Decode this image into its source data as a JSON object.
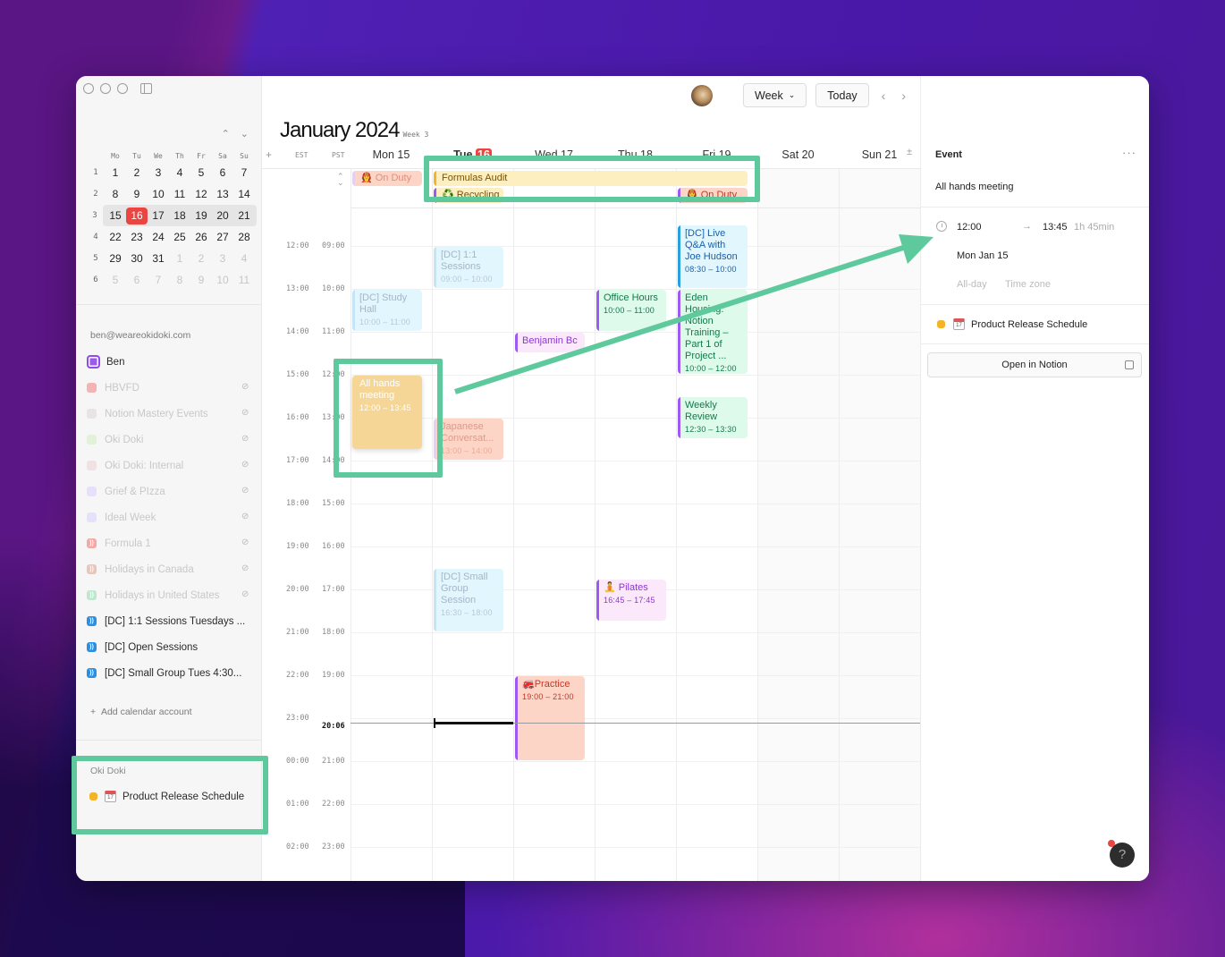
{
  "window": {
    "title": "January 2024",
    "week_label": "Week 3"
  },
  "mini_calendar": {
    "weekday_headers": [
      "Mo",
      "Tu",
      "We",
      "Th",
      "Fr",
      "Sa",
      "Su"
    ],
    "weeks": [
      {
        "num": "1",
        "days": [
          "1",
          "2",
          "3",
          "4",
          "5",
          "6",
          "7"
        ],
        "muted": []
      },
      {
        "num": "2",
        "days": [
          "8",
          "9",
          "10",
          "11",
          "12",
          "13",
          "14"
        ],
        "muted": []
      },
      {
        "num": "3",
        "days": [
          "15",
          "16",
          "17",
          "18",
          "19",
          "20",
          "21"
        ],
        "muted": [],
        "current": true,
        "today_index": 1
      },
      {
        "num": "4",
        "days": [
          "22",
          "23",
          "24",
          "25",
          "26",
          "27",
          "28"
        ],
        "muted": []
      },
      {
        "num": "5",
        "days": [
          "29",
          "30",
          "31",
          "1",
          "2",
          "3",
          "4"
        ],
        "muted": [
          3,
          4,
          5,
          6
        ]
      },
      {
        "num": "6",
        "days": [
          "5",
          "6",
          "7",
          "8",
          "9",
          "10",
          "11"
        ],
        "muted": [
          0,
          1,
          2,
          3,
          4,
          5,
          6
        ]
      }
    ]
  },
  "sidebar": {
    "account_email": "ben@weareokidoki.com",
    "calendars": [
      {
        "label": "Ben",
        "color": "#9c5af2",
        "hidden": false,
        "type": "checkbox"
      },
      {
        "label": "HBVFD",
        "color": "#f4b4b4",
        "hidden": true,
        "type": "square"
      },
      {
        "label": "Notion Mastery Events",
        "color": "#e8e4e4",
        "hidden": true,
        "type": "square"
      },
      {
        "label": "Oki Doki",
        "color": "#e2f2d8",
        "hidden": true,
        "type": "square"
      },
      {
        "label": "Oki Doki: Internal",
        "color": "#f0e2e2",
        "hidden": true,
        "type": "square"
      },
      {
        "label": "Grief & PIzza",
        "color": "#e6e0fa",
        "hidden": true,
        "type": "square"
      },
      {
        "label": "Ideal Week",
        "color": "#e6e0fa",
        "hidden": true,
        "type": "square"
      },
      {
        "label": "Formula 1",
        "color": "#f4a8a8",
        "hidden": true,
        "type": "rss"
      },
      {
        "label": "Holidays in Canada",
        "color": "#e8c6bc",
        "hidden": true,
        "type": "rss"
      },
      {
        "label": "Holidays in United States",
        "color": "#bfe6cf",
        "hidden": true,
        "type": "rss"
      },
      {
        "label": "[DC] 1:1 Sessions Tuesdays ...",
        "color": "#2a8fe0",
        "hidden": false,
        "type": "rss"
      },
      {
        "label": "[DC] Open Sessions",
        "color": "#2a8fe0",
        "hidden": false,
        "type": "rss"
      },
      {
        "label": "[DC] Small Group Tues 4:30...",
        "color": "#2a8fe0",
        "hidden": false,
        "type": "rss"
      }
    ],
    "add_account_label": "Add calendar account",
    "notion_section": {
      "title": "Oki Doki",
      "item": "Product Release Schedule",
      "color": "#f4b429"
    }
  },
  "toolbar": {
    "view_label": "Week",
    "today_label": "Today"
  },
  "day_headers": [
    {
      "label": "Mon 15"
    },
    {
      "label": "Tue 16",
      "today": true
    },
    {
      "label": "Wed 17"
    },
    {
      "label": "Thu 18"
    },
    {
      "label": "Fri 19"
    },
    {
      "label": "Sat 20"
    },
    {
      "label": "Sun 21"
    }
  ],
  "timezones": {
    "primary": "EST",
    "secondary": "PST"
  },
  "time_labels": [
    {
      "est": "12:00",
      "pst": "09:00"
    },
    {
      "est": "13:00",
      "pst": "10:00"
    },
    {
      "est": "14:00",
      "pst": "11:00"
    },
    {
      "est": "15:00",
      "pst": "12:00"
    },
    {
      "est": "16:00",
      "pst": "13:00"
    },
    {
      "est": "17:00",
      "pst": "14:00"
    },
    {
      "est": "18:00",
      "pst": "15:00"
    },
    {
      "est": "19:00",
      "pst": "16:00"
    },
    {
      "est": "20:00",
      "pst": "17:00"
    },
    {
      "est": "21:00",
      "pst": "18:00"
    },
    {
      "est": "22:00",
      "pst": "19:00"
    },
    {
      "est": "23:00",
      "pst": "20:06"
    },
    {
      "est": "00:00",
      "pst": "21:00"
    },
    {
      "est": "01:00",
      "pst": "22:00"
    },
    {
      "est": "02:00",
      "pst": "23:00"
    }
  ],
  "current_time": "20:06",
  "all_day_events": [
    {
      "title": "👩‍🚒 On Duty",
      "day": 0,
      "span": 1,
      "row": 0,
      "bg": "#fdd5c6",
      "bar": "#e5d0f5",
      "color": "#e08f7e",
      "faded": true
    },
    {
      "title": "Formulas Audit",
      "day": 1,
      "span": 4,
      "row": 0,
      "bg": "#fdefc0",
      "bar": "#f4b429",
      "color": "#7a5200"
    },
    {
      "title": "♻️ Recycling",
      "day": 1,
      "span": 1,
      "row": 1,
      "bg": "#fdefc0",
      "bar": "#9c5af2",
      "color": "#7a5200"
    },
    {
      "title": "👩‍🚒 On Duty",
      "day": 4,
      "span": 1,
      "row": 1,
      "bg": "#fdd5c6",
      "bar": "#9c5af2",
      "color": "#c0392b"
    }
  ],
  "events": [
    {
      "title": "[DC] 1:1 Sessions",
      "time": "09:00 – 10:00",
      "day": 1,
      "start": 9.0,
      "end": 10.0,
      "bg": "#e2f6fd",
      "bar": "#c4e4f7",
      "color": "#a4b6c8",
      "faded": true
    },
    {
      "title": "[DC] Study Hall",
      "time": "10:00 – 11:00",
      "day": 0,
      "start": 10.0,
      "end": 11.0,
      "bg": "#e2f6fd",
      "bar": "#c4e4f7",
      "color": "#a4b6c8",
      "faded": true
    },
    {
      "title": "[DC] Live Q&A with Joe Hudson",
      "time": "08:30 – 10:00",
      "day": 4,
      "start": 8.5,
      "end": 10.0,
      "bg": "#e2f6fd",
      "bar": "#2a9fe0",
      "color": "#1a5fa8"
    },
    {
      "title": "Office Hours",
      "time": "10:00 – 11:00",
      "day": 3,
      "start": 10.0,
      "end": 11.0,
      "bg": "#ddfaea",
      "bar": "#9c5af2",
      "color": "#137a4a"
    },
    {
      "title": "Eden Housing: Notion Training – Part 1 of Project ...",
      "time": "10:00 – 12:00",
      "day": 4,
      "start": 10.0,
      "end": 12.0,
      "bg": "#ddfaea",
      "bar": "#9c5af2",
      "color": "#137a4a"
    },
    {
      "title": "Benjamin Bc",
      "time": "",
      "day": 2,
      "start": 11.0,
      "end": 11.5,
      "bg": "#fbe8fb",
      "bar": "#9c5af2",
      "color": "#8a3ad0"
    },
    {
      "title": "All hands meeting",
      "time": "12:00 – 13:45",
      "day": 0,
      "start": 12.0,
      "end": 13.75,
      "bg": "#f5d697",
      "bar": "#f5d697",
      "color": "#ffffff",
      "selected": true
    },
    {
      "title": "Weekly Review",
      "time": "12:30 – 13:30",
      "day": 4,
      "start": 12.5,
      "end": 13.5,
      "bg": "#ddfaea",
      "bar": "#9c5af2",
      "color": "#137a4a"
    },
    {
      "title": "Japanese Conversat...",
      "time": "13:00 – 14:00",
      "day": 1,
      "start": 13.0,
      "end": 14.0,
      "bg": "#fdd5c6",
      "bar": "#e5d0f5",
      "color": "#e09a88",
      "faded": true
    },
    {
      "title": "[DC] Small Group Session",
      "time": "16:30 – 18:00",
      "day": 1,
      "start": 16.5,
      "end": 18.0,
      "bg": "#e2f6fd",
      "bar": "#c4e4f7",
      "color": "#a4b6c8",
      "faded": true
    },
    {
      "title": "🧘 Pilates",
      "time": "16:45 – 17:45",
      "day": 3,
      "start": 16.75,
      "end": 17.75,
      "bg": "#fbe8fb",
      "bar": "#9c5af2",
      "color": "#8a3ad0"
    },
    {
      "title": "🚒Practice",
      "time": "19:00 – 21:00",
      "day": 2,
      "start": 19.0,
      "end": 21.0,
      "bg": "#fdd5c6",
      "bar": "#9c5af2",
      "color": "#c0392b"
    }
  ],
  "event_panel": {
    "heading": "Event",
    "name": "All hands meeting",
    "start": "12:00",
    "end": "13:45",
    "duration": "1h 45min",
    "date": "Mon Jan 15",
    "all_day_label": "All-day",
    "timezone_label": "Time zone",
    "calendar": "Product Release Schedule",
    "calendar_color": "#f4b429",
    "open_label": "Open in Notion"
  },
  "help_label": "?"
}
